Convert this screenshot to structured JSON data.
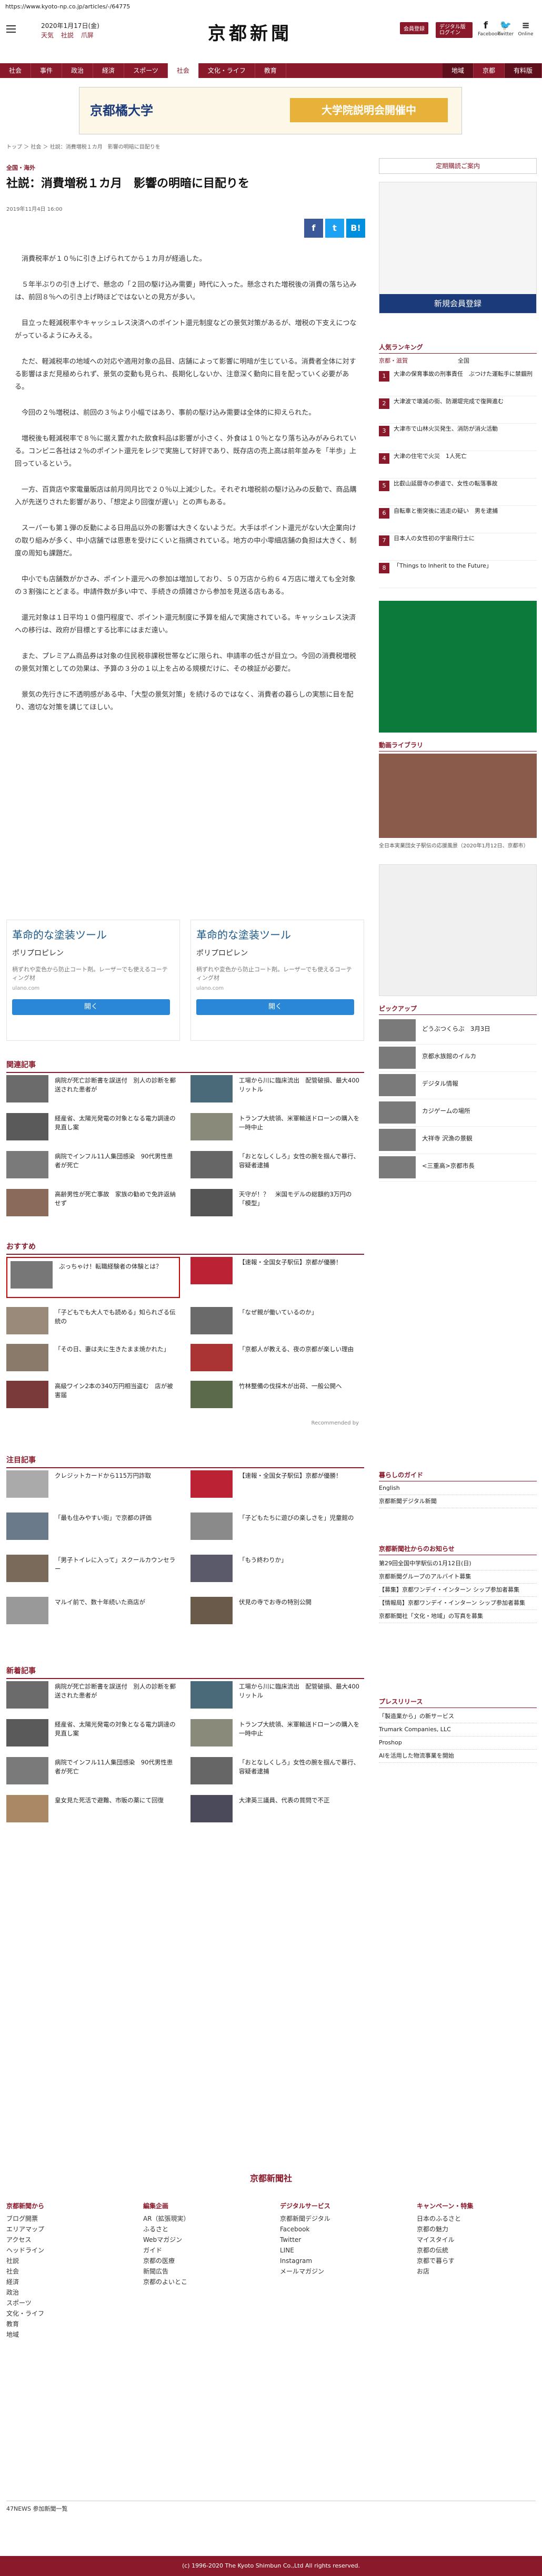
{
  "url": "https://www.kyoto-np.co.jp/articles/-/64775",
  "header": {
    "date": "2020年1月17日(金)",
    "links": [
      "天気",
      "社説",
      "爪屏"
    ],
    "logo": "京都新聞",
    "login": "会員登録",
    "digital": "デジタル版ログイン",
    "social": [
      {
        "icon": "f",
        "label": "Facebook"
      },
      {
        "icon": "🐦",
        "label": "Twitter"
      },
      {
        "icon": "≡",
        "label": "Online"
      }
    ]
  },
  "nav": [
    "社会",
    "事件",
    "政治",
    "経済",
    "スポーツ",
    "社会",
    "文化・ライフ",
    "教育",
    "",
    "",
    "",
    "",
    "",
    "",
    "地域",
    "京都",
    "有料版"
  ],
  "nav_selected": "社会",
  "top_ad": {
    "left": "京都橘大学",
    "right": "大学院説明会開催中"
  },
  "breadcrumb": "トップ ＞ 社会 ＞ 社説：消費増税１カ月　影響の明暗に目配りを",
  "article": {
    "category": "全国・海外",
    "title": "社説：消費増税１カ月　影響の明暗に目配りを",
    "date": "2019年11月4日 16:00",
    "share": [
      "f",
      "t",
      "B!"
    ],
    "paragraphs": [
      "消費税率が１０％に引き上げられてから１カ月が経過した。",
      "５年半ぶりの引き上げで、懸念の「２回の駆け込み需要」時代に入った。懸念された増税後の消費の落ち込みは、前回８％への引き上げ時ほどではないとの見方が多い。",
      "目立った軽減税率やキャッシュレス決済へのポイント還元制度などの景気対策があるが、増税の下支えにつながっているようにみえる。",
      "ただ、軽減税率の地域への対応や適用対象の品目、店舗によって影響に明暗が生じている。消費者全体に対する影響はまだ見極められず、景気の変動も見られ、長期化しないか、注意深く動向に目を配っていく必要がある。",
      "今回の２％増税は、前回の３％より小幅ではあり、事前の駆け込み需要は全体的に抑えられた。",
      "増税後も軽減税率で８％に据え置かれた飲食料品は影響が小さく、外食は１０％となり落ち込みがみられている。コンビニ各社は２％のポイント還元をレジで実施して好評であり、既存店の売上高は前年並みを「半歩」上回っているという。",
      "一方、百貨店や家電量販店は前月同月比で２０％以上減少した。それぞれ増税前の駆け込みの反動で、商品購入が先送りされた影響があり、「想定より回復が遅い」との声もある。",
      "スーパーも第１弾の反動による日用品以外の影響は大きくないようだ。大手はポイント還元がない大企業向けの取り組みが多く、中小店舗では恩恵を受けにくいと指摘されている。地方の中小零細店舗の負担は大きく、制度の周知も課題だ。",
      "中小でも店舗数がかさみ、ポイント還元への参加は増加しており、５０万店から約６４万店に増えても全対象の３割強にとどまる。申請件数が多い中で、手続きの煩雑さから参加を見送る店もある。",
      "還元対象は１日平均１０億円程度で、ポイント還元制度に予算を組んで実施されている。キャッシュレス決済への移行は、政府が目標とする比率にはまだ遠い。",
      "また、プレミアム商品券は対象の住民税非課税世帯などに限られ、申請率の低さが目立つ。今回の消費税増税の景気対策としての効果は、予算の３分の１以上を占める規模だけに、その検証が必要だ。",
      "景気の先行きに不透明感がある中、「大型の景気対策」を続けるのではなく、消費者の暮らしの実態に目を配り、適切な対策を講じてほしい。"
    ]
  },
  "content_ads": [
    {
      "title": "革命的な塗装ツール",
      "sub": "ポリプロピレン",
      "desc": "柄ずれや変色から防止コート剤。レーザーでも使えるコーティング材",
      "url": "ulano.com",
      "button": "開く"
    },
    {
      "title": "革命的な塗装ツール",
      "sub": "ポリプロピレン",
      "desc": "柄ずれや変色から防止コート剤。レーザーでも使えるコーティング材",
      "url": "ulano.com",
      "button": "開く"
    }
  ],
  "related": {
    "title": "関連記事",
    "items": [
      "病院が死亡診断書を誤送付　別人の診断を郵送された患者が",
      "工場から川に臨床流出　配管破損、最大400リットル",
      "経産省、太陽光発電の対象となる電力調達の見直し案",
      "トランプ大統領、米軍輸送ドローンの購入を一時中止",
      "病院でインフル11人集団感染　90代男性患者が死亡",
      "「おとなしくしろ」女性の腕を掴んで暴行、容疑者逮捕",
      "高齢男性が死亡事故　家族の勧めで免許返納せず",
      "天守が！？　米国モデルの総額約3万円の「模型」"
    ]
  },
  "recommend": {
    "title": "おすすめ",
    "items": [
      "ぶっちゃけ！転職経験者の体験とは？",
      "【速報・全国女子駅伝】京都が優勝！",
      "「子どもでも大人でも読める」知られざる伝統の",
      "「なぜ親が働いているのか」",
      "「その日、妻は夫に生きたまま焼かれた」",
      "「京都人が教える、夜の京都が楽しい理由",
      "高級ワイン2本の340万円相当盗む　店が被害届",
      "竹林整備の伐採木が出荷、一般公開へ"
    ],
    "recommended_by": "Recommended by"
  },
  "popular": {
    "title": "注目記事",
    "items": [
      "クレジットカードから115万円詐取",
      "【速報・全国女子駅伝】京都が優勝！",
      "「最も住みやすい街」で京都の評価",
      "「子どもたちに遊びの楽しさを」児童館の",
      "「男子トイレに入って」スクールカウンセラー",
      "「もう終わりか」",
      "マルイ前で、数十年続いた商店が",
      "伏見の寺でお寺の特別公開"
    ]
  },
  "latest": {
    "title": "新着記事",
    "items": [
      "病院が死亡診断書を誤送付　別人の診断を郵送された患者が",
      "工場から川に臨床流出　配管破損、最大400リットル",
      "経産省、太陽光発電の対象となる電力調達の見直し案",
      "トランプ大統領、米軍輸送ドローンの購入を一時中止",
      "病院でインフル11人集団感染　90代男性患者が死亡",
      "「おとなしくしろ」女性の腕を掴んで暴行、容疑者逮捕",
      "皇女見た死活で避難、市販の薬にて回復",
      "大津英三議員、代表の質問で不正"
    ]
  },
  "sidebar": {
    "subscribe": "定期購読ご案内",
    "banner": "新規会員登録",
    "ranking_title": "人気ランキング",
    "ranking_tabs": [
      "全国",
      "京都・滋賀"
    ],
    "ranking": [
      "大津の保育事故の刑事責任　ぶつけた運転手に禁錮刑",
      "大津波で壊滅の街、防潮堤完成で復興進む",
      "大津市で山林火災発生、消防が消火活動",
      "大津の住宅で火災　1人死亡",
      "比叡山延暦寺の参道で、女性の転落事故",
      "自転車と衝突後に逃走の疑い　男を逮捕",
      "日本人の女性初の宇宙飛行士に",
      "「Things to Inherit to the Future」"
    ],
    "photo_title": "動画ライブラリ",
    "photo_caption": "全日本実業団女子駅伝の応援風景（2020年1月12日、京都市）",
    "pickup_title": "ピックアップ",
    "pickup": [
      "どうぶつくらぶ　3月3日",
      "京都水族館のイルカ",
      "デジタル情報",
      "カジゲームの場所",
      "大祥寺 沢漁の景観",
      "<三重高>京都市長"
    ],
    "guide_title": "暮らしのガイド",
    "guide": [
      "English",
      "京都新聞デジタル新聞"
    ],
    "notice_title": "京都新聞社からのお知らせ",
    "notice": [
      "第29回全国中学駅伝の1月12日(日)",
      "京都新聞グループのアルバイト募集",
      "【募集】京都ワンデイ・インターン シップ参加者募集",
      "【情報局】京都ワンデイ・インターン シップ参加者募集",
      "京都新聞社「文化・地域」の写真を募集"
    ],
    "press_title": "プレスリリース",
    "press": [
      "「製造業から」の新サービス",
      "Trumark Companies, LLC",
      "Proshop",
      "AIを活用した物流事業を開始"
    ]
  },
  "footer": {
    "logo": "京都新聞社",
    "cols": [
      {
        "h": "京都新聞から",
        "items": [
          "ブログ開票",
          "エリアマップ",
          "アクセス",
          "ヘッドライン",
          "社説",
          "社会",
          "経済",
          "政治",
          "スポーツ",
          "文化・ライフ",
          "教育",
          "地域"
        ]
      },
      {
        "h": "編集企画",
        "items": [
          "AR（拡張現実）",
          "ふるさと",
          "Webマガジン",
          "ガイド",
          "京都の医療",
          "新聞広告",
          "京都のよいとこ"
        ]
      },
      {
        "h": "デジタルサービス",
        "items": [
          "京都新聞デジタル",
          "Facebook",
          "Twitter",
          "LINE",
          "Instagram",
          "メールマガジン"
        ]
      },
      {
        "h": "キャンペーン・特集",
        "items": [
          "日本のふるさと",
          "京都の魅力",
          "マイスタイル",
          "京都の伝統",
          "京都で暮らす",
          "お店"
        ]
      }
    ],
    "news_label": "47NEWS 参加新聞一覧",
    "copyright": "(c) 1996-2020 The Kyoto Shimbun Co.,Ltd All rights reserved."
  }
}
